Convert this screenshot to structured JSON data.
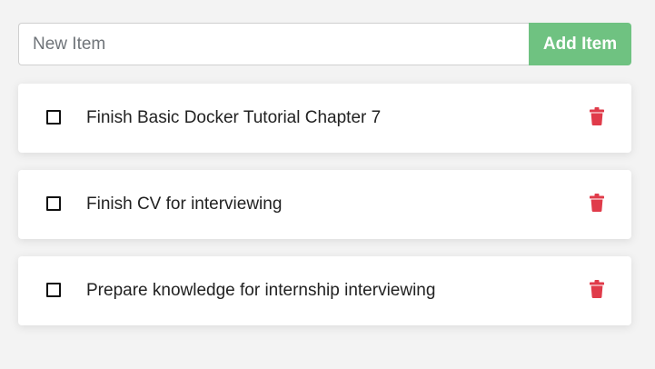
{
  "add_form": {
    "placeholder": "New Item",
    "value": "",
    "button_label": "Add Item"
  },
  "todos": [
    {
      "text": "Finish Basic Docker Tutorial Chapter 7",
      "checked": false,
      "icon": "trash-icon"
    },
    {
      "text": "Finish CV for interviewing",
      "checked": false,
      "icon": "trash-icon"
    },
    {
      "text": "Prepare knowledge for internship interviewing",
      "checked": false,
      "icon": "trash-icon"
    }
  ],
  "colors": {
    "accent": "#6fc281",
    "delete": "#e03b4a",
    "background": "#f3f3f3"
  }
}
